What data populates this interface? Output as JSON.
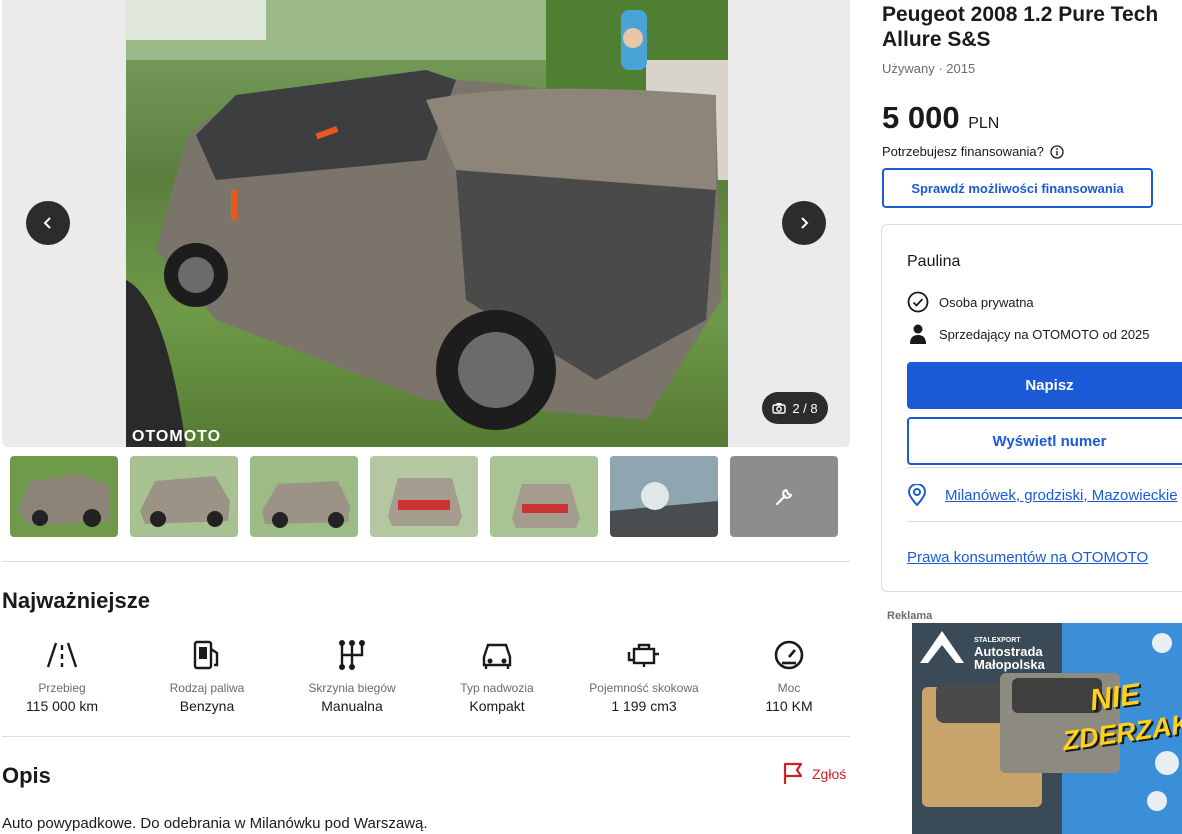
{
  "gallery": {
    "counter": "2 / 8",
    "watermark": "OTOMOTO",
    "thumbnails": [
      {
        "label": "photo-1"
      },
      {
        "label": "photo-2"
      },
      {
        "label": "photo-3"
      },
      {
        "label": "photo-4"
      },
      {
        "label": "photo-5"
      },
      {
        "label": "photo-6"
      },
      {
        "label": "photo-7"
      }
    ]
  },
  "key_specs": {
    "title": "Najważniejsze",
    "items": [
      {
        "label": "Przebieg",
        "value": "115 000 km",
        "icon": "road-icon"
      },
      {
        "label": "Rodzaj paliwa",
        "value": "Benzyna",
        "icon": "fuel-pump-icon"
      },
      {
        "label": "Skrzynia biegów",
        "value": "Manualna",
        "icon": "gearbox-icon"
      },
      {
        "label": "Typ nadwozia",
        "value": "Kompakt",
        "icon": "car-body-icon"
      },
      {
        "label": "Pojemność skokowa",
        "value": "1 199 cm3",
        "icon": "engine-icon"
      },
      {
        "label": "Moc",
        "value": "110 KM",
        "icon": "speedometer-icon"
      }
    ]
  },
  "description": {
    "title": "Opis",
    "report_label": "Zgłoś",
    "text": "Auto powypadkowe. Do odebrania w Milanówku pod Warszawą."
  },
  "listing": {
    "title": "Peugeot 2008 1.2 Pure Tech Allure S&S",
    "subtitle": "Używany · 2015",
    "price": "5 000",
    "currency": "PLN",
    "financing_question": "Potrzebujesz finansowania?",
    "financing_button": "Sprawdź możliwości finansowania"
  },
  "seller": {
    "name": "Paulina",
    "type": "Osoba prywatna",
    "since": "Sprzedający na OTOMOTO od 2025",
    "write_button": "Napisz",
    "phone_button": "Wyświetl numer",
    "location": "Milanówek, grodziski, Mazowieckie",
    "consumer_rights": "Prawa konsumentów na OTOMOTO"
  },
  "ad": {
    "label": "Reklama",
    "brand_small": "STALEXPORT",
    "brand_line1": "Autostrada",
    "brand_line2": "Małopolska",
    "slogan_1": "NIE",
    "slogan_2": "ZDERZAKUJ"
  },
  "colors": {
    "accent": "#1a5ad6",
    "report": "#cc2222"
  }
}
